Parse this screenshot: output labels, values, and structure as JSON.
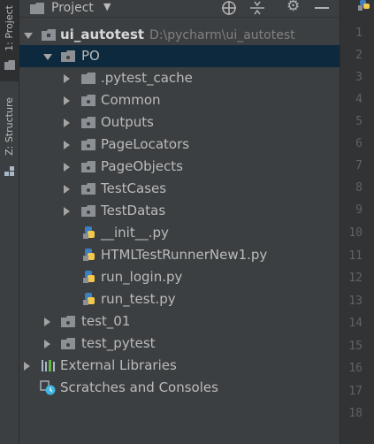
{
  "toolstrip": {
    "project_tab": "1: Project",
    "structure_tab": "Z: Structure"
  },
  "header": {
    "title": "Project",
    "icons": [
      "globe-target-icon",
      "collapse-all-icon",
      "gear-icon",
      "minimize-icon"
    ]
  },
  "tree": {
    "root": {
      "name": "ui_autotest",
      "path": "D:\\pycharm\\ui_autotest"
    },
    "po_folder": "PO",
    "po_children_folders": [
      ".pytest_cache",
      "Common",
      "Outputs",
      "PageLocators",
      "PageObjects",
      "TestCases",
      "TestDatas"
    ],
    "po_children_files": [
      "__init__.py",
      "HTMLTestRunnerNew1.py",
      "run_login.py",
      "run_test.py"
    ],
    "root_folders": [
      "test_01",
      "test_pytest"
    ],
    "external_libraries": "External Libraries",
    "scratches": "Scratches and Consoles"
  },
  "gutter": {
    "line_numbers": [
      "1",
      "2",
      "3",
      "4",
      "5",
      "6",
      "7",
      "8",
      "9",
      "10",
      "11",
      "12",
      "13",
      "14",
      "15",
      "16",
      "17",
      "18"
    ]
  },
  "colors": {
    "panel_bg": "#3c3f41",
    "selection": "#0d293e",
    "folder": "#8c9095",
    "python_blue": "#3d7fc1",
    "python_yellow": "#f2c94c"
  }
}
